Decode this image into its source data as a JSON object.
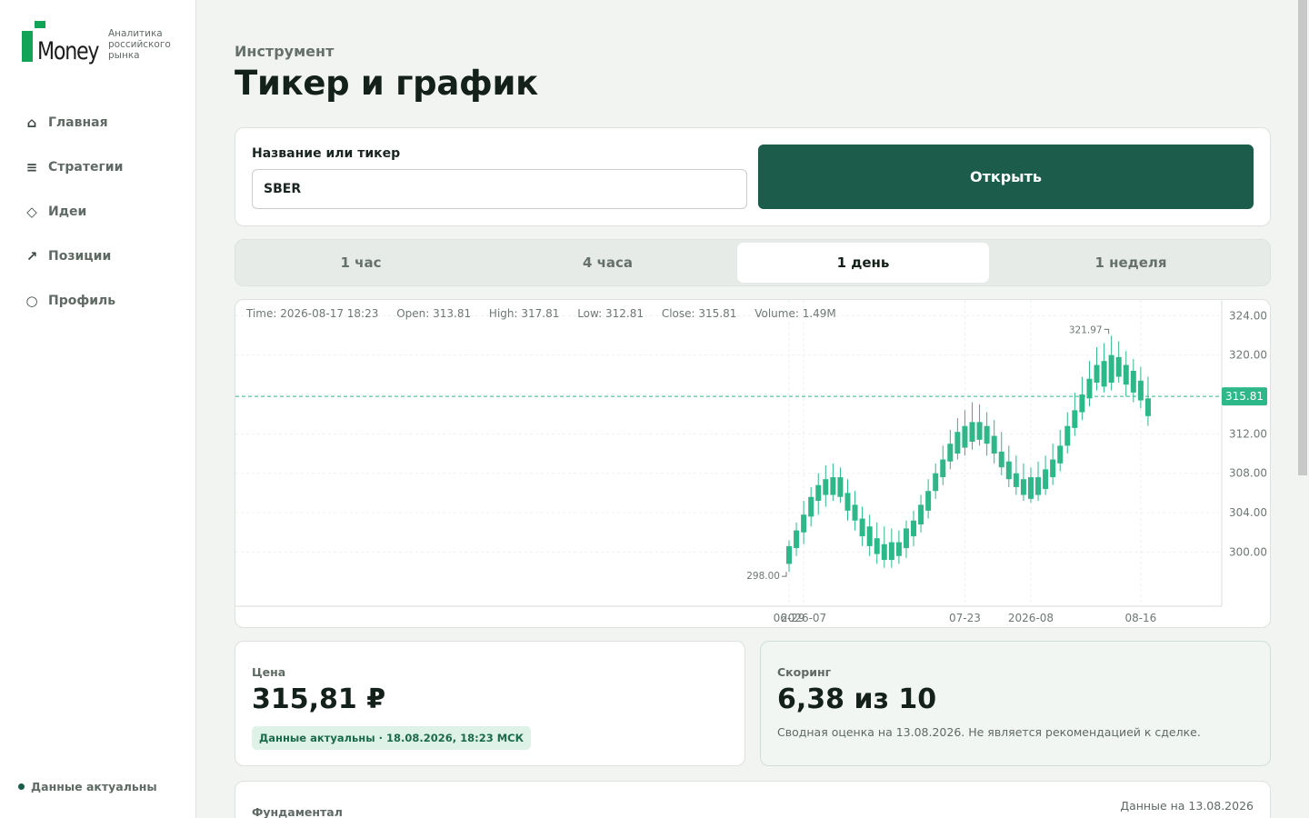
{
  "sidebar": {
    "logo_word": "Money",
    "logo_tagline": [
      "Аналитика",
      "российского",
      "рынка"
    ],
    "items": [
      {
        "label": "Главная",
        "icon": "home-icon",
        "glyph": "⌂"
      },
      {
        "label": "Стратегии",
        "icon": "menu-icon",
        "glyph": "≡"
      },
      {
        "label": "Идеи",
        "icon": "diamond-icon",
        "glyph": "◇"
      },
      {
        "label": "Позиции",
        "icon": "trend-arrow-icon",
        "glyph": "↗"
      },
      {
        "label": "Профиль",
        "icon": "profile-icon",
        "glyph": "○"
      }
    ],
    "status": "Данные актуальны"
  },
  "header": {
    "eyebrow": "Инструмент",
    "title": "Тикер и график"
  },
  "search": {
    "label": "Название или тикер",
    "value": "SBER",
    "button": "Открыть"
  },
  "tabs": [
    {
      "label": "1 час",
      "active": false
    },
    {
      "label": "4 часа",
      "active": false
    },
    {
      "label": "1 день",
      "active": true
    },
    {
      "label": "1 неделя",
      "active": false
    }
  ],
  "chart_data": {
    "type": "candlestick",
    "legend": {
      "time": "Time: 2026-08-17 18:23",
      "open": "Open: 313.81",
      "high": "High: 317.81",
      "low": "Low: 312.81",
      "close": "Close: 315.81",
      "volume": "Volume: 1.49M"
    },
    "ylim": [
      294.5,
      325.6
    ],
    "yticks": [
      "300.00",
      "304.00",
      "308.00",
      "312.00",
      "316.00",
      "320.00",
      "324.00"
    ],
    "xticks": [
      {
        "label": "06-29",
        "date": "2026-06-29"
      },
      {
        "label": "2026-07",
        "date": "2026-07-01"
      },
      {
        "label": "07-23",
        "date": "2026-07-23"
      },
      {
        "label": "2026-08",
        "date": "2026-08-01"
      },
      {
        "label": "08-16",
        "date": "2026-08-16"
      }
    ],
    "last_price": "315.81",
    "max_label": "321.97",
    "min_label": "298.00",
    "candles": [
      {
        "date": "2026-06-29",
        "open": 298.8,
        "high": 301.2,
        "low": 298.0,
        "close": 300.6
      },
      {
        "date": "2026-06-30",
        "open": 300.4,
        "high": 303.0,
        "low": 299.6,
        "close": 302.2
      },
      {
        "date": "2026-07-01",
        "open": 302.0,
        "high": 305.2,
        "low": 300.8,
        "close": 303.8
      },
      {
        "date": "2026-07-02",
        "open": 303.6,
        "high": 306.6,
        "low": 302.6,
        "close": 305.6
      },
      {
        "date": "2026-07-03",
        "open": 305.2,
        "high": 308.0,
        "low": 303.8,
        "close": 306.8
      },
      {
        "date": "2026-07-04",
        "open": 305.8,
        "high": 308.8,
        "low": 304.6,
        "close": 307.4
      },
      {
        "date": "2026-07-05",
        "open": 307.6,
        "high": 309.0,
        "low": 305.2,
        "close": 305.8
      },
      {
        "date": "2026-07-06",
        "open": 307.6,
        "high": 308.6,
        "low": 305.0,
        "close": 305.6
      },
      {
        "date": "2026-07-07",
        "open": 306.0,
        "high": 307.4,
        "low": 303.2,
        "close": 304.2
      },
      {
        "date": "2026-07-08",
        "open": 304.8,
        "high": 306.2,
        "low": 302.2,
        "close": 303.2
      },
      {
        "date": "2026-07-09",
        "open": 303.4,
        "high": 304.6,
        "low": 300.6,
        "close": 301.6
      },
      {
        "date": "2026-07-10",
        "open": 302.6,
        "high": 303.8,
        "low": 299.6,
        "close": 300.6
      },
      {
        "date": "2026-07-11",
        "open": 301.4,
        "high": 303.0,
        "low": 298.8,
        "close": 299.8
      },
      {
        "date": "2026-07-12",
        "open": 300.8,
        "high": 302.6,
        "low": 298.4,
        "close": 299.2
      },
      {
        "date": "2026-07-13",
        "open": 299.2,
        "high": 302.4,
        "low": 298.4,
        "close": 301.0
      },
      {
        "date": "2026-07-14",
        "open": 299.6,
        "high": 302.2,
        "low": 298.8,
        "close": 301.0
      },
      {
        "date": "2026-07-15",
        "open": 300.4,
        "high": 303.2,
        "low": 299.4,
        "close": 302.4
      },
      {
        "date": "2026-07-16",
        "open": 301.6,
        "high": 304.2,
        "low": 300.6,
        "close": 303.2
      },
      {
        "date": "2026-07-17",
        "open": 302.8,
        "high": 305.8,
        "low": 302.0,
        "close": 304.8
      },
      {
        "date": "2026-07-18",
        "open": 304.2,
        "high": 307.4,
        "low": 303.4,
        "close": 306.2
      },
      {
        "date": "2026-07-19",
        "open": 306.2,
        "high": 309.0,
        "low": 305.4,
        "close": 308.0
      },
      {
        "date": "2026-07-20",
        "open": 307.6,
        "high": 310.8,
        "low": 306.8,
        "close": 309.4
      },
      {
        "date": "2026-07-21",
        "open": 309.2,
        "high": 312.4,
        "low": 308.4,
        "close": 311.0
      },
      {
        "date": "2026-07-22",
        "open": 310.0,
        "high": 313.6,
        "low": 309.4,
        "close": 312.2
      },
      {
        "date": "2026-07-23",
        "open": 310.6,
        "high": 314.4,
        "low": 309.8,
        "close": 312.8
      },
      {
        "date": "2026-07-24",
        "open": 311.2,
        "high": 315.2,
        "low": 310.4,
        "close": 313.2
      },
      {
        "date": "2026-07-25",
        "open": 311.4,
        "high": 315.0,
        "low": 310.8,
        "close": 313.2
      },
      {
        "date": "2026-07-26",
        "open": 312.8,
        "high": 314.2,
        "low": 309.8,
        "close": 311.0
      },
      {
        "date": "2026-07-27",
        "open": 311.8,
        "high": 313.4,
        "low": 309.0,
        "close": 310.0
      },
      {
        "date": "2026-07-28",
        "open": 310.2,
        "high": 312.2,
        "low": 307.8,
        "close": 308.6
      },
      {
        "date": "2026-07-29",
        "open": 309.2,
        "high": 310.8,
        "low": 306.6,
        "close": 307.4
      },
      {
        "date": "2026-07-30",
        "open": 308.0,
        "high": 309.8,
        "low": 305.8,
        "close": 306.6
      },
      {
        "date": "2026-07-31",
        "open": 307.4,
        "high": 309.0,
        "low": 305.2,
        "close": 305.8
      },
      {
        "date": "2026-08-01",
        "open": 305.4,
        "high": 308.6,
        "low": 305.0,
        "close": 307.6
      },
      {
        "date": "2026-08-02",
        "open": 305.8,
        "high": 309.2,
        "low": 305.2,
        "close": 307.6
      },
      {
        "date": "2026-08-03",
        "open": 306.4,
        "high": 309.8,
        "low": 305.8,
        "close": 308.4
      },
      {
        "date": "2026-08-04",
        "open": 307.6,
        "high": 311.0,
        "low": 306.8,
        "close": 309.4
      },
      {
        "date": "2026-08-05",
        "open": 309.0,
        "high": 312.4,
        "low": 308.2,
        "close": 310.8
      },
      {
        "date": "2026-08-06",
        "open": 310.8,
        "high": 314.2,
        "low": 310.0,
        "close": 312.8
      },
      {
        "date": "2026-08-07",
        "open": 312.6,
        "high": 316.2,
        "low": 311.8,
        "close": 314.4
      },
      {
        "date": "2026-08-08",
        "open": 314.2,
        "high": 317.8,
        "low": 313.4,
        "close": 316.0
      },
      {
        "date": "2026-08-09",
        "open": 315.6,
        "high": 319.4,
        "low": 314.8,
        "close": 317.6
      },
      {
        "date": "2026-08-10",
        "open": 317.2,
        "high": 320.8,
        "low": 316.4,
        "close": 319.0
      },
      {
        "date": "2026-08-11",
        "open": 316.8,
        "high": 321.2,
        "low": 316.2,
        "close": 319.4
      },
      {
        "date": "2026-08-12",
        "open": 317.2,
        "high": 321.97,
        "low": 316.4,
        "close": 320.0
      },
      {
        "date": "2026-08-13",
        "open": 319.8,
        "high": 321.4,
        "low": 317.2,
        "close": 317.8
      },
      {
        "date": "2026-08-14",
        "open": 319.0,
        "high": 320.4,
        "low": 315.8,
        "close": 317.0
      },
      {
        "date": "2026-08-15",
        "open": 318.4,
        "high": 319.6,
        "low": 315.2,
        "close": 316.2
      },
      {
        "date": "2026-08-16",
        "open": 317.4,
        "high": 318.8,
        "low": 314.6,
        "close": 315.4
      },
      {
        "date": "2026-08-17",
        "open": 315.6,
        "high": 317.81,
        "low": 312.81,
        "close": 313.81
      }
    ],
    "colors": {
      "candle": "#2eb88a",
      "price_badge": "#2eb88a",
      "price_line": "#2eb88a"
    }
  },
  "price_card": {
    "label": "Цена",
    "value": "315,81 ₽",
    "badge": "Данные актуальны · 18.08.2026, 18:23 МСК"
  },
  "score_card": {
    "label": "Скоринг",
    "value": "6,38 из 10",
    "note": "Сводная оценка на 13.08.2026. Не является рекомендацией к сделке."
  },
  "fundamentals": {
    "label": "Фундаментал",
    "date": "Данные на 13.08.2026"
  },
  "colors": {
    "accent": "#1b5c4b",
    "brand_green": "#12a456",
    "background": "#f2f4f1"
  }
}
